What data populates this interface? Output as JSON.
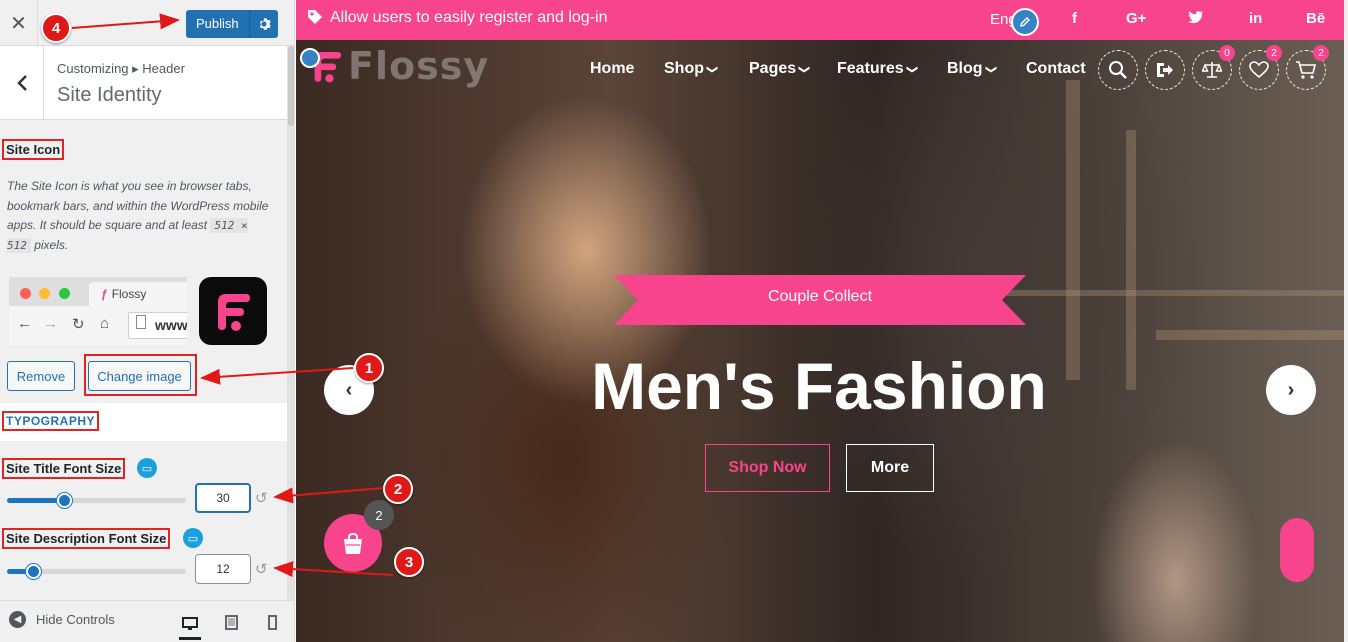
{
  "sidebar": {
    "close_label": "✕",
    "publish_label": "Publish",
    "breadcrumb": "Customizing ▸ Header",
    "section_title": "Site Identity",
    "site_icon": {
      "title": "Site Icon",
      "description": "The Site Icon is what you see in browser tabs, bookmark bars, and within the WordPress mobile apps. It should be square and at least",
      "size": "512 × 512",
      "size_suffix": "pixels.",
      "preview_tab_label": "Flossy",
      "preview_url": "www.",
      "remove_label": "Remove",
      "change_label": "Change image"
    },
    "typography_title": "TYPOGRAPHY",
    "title_font": {
      "label": "Site Title Font Size",
      "value": "30",
      "slider_fraction": 0.32
    },
    "desc_font": {
      "label": "Site Description Font Size",
      "value": "12",
      "slider_fraction": 0.15
    },
    "hide_controls_label": "Hide Controls"
  },
  "preview": {
    "notice": "Allow users to easily register and log-in",
    "lang": "Eng",
    "social": [
      "f",
      "G+",
      "twitter",
      "in",
      "Bē"
    ],
    "logo_text": "Flossy",
    "nav": [
      {
        "label": "Home",
        "has_dropdown": false
      },
      {
        "label": "Shop",
        "has_dropdown": true
      },
      {
        "label": "Pages",
        "has_dropdown": true
      },
      {
        "label": "Features",
        "has_dropdown": true
      },
      {
        "label": "Blog",
        "has_dropdown": true
      },
      {
        "label": "Contact",
        "has_dropdown": false
      }
    ],
    "badges": {
      "compare": "0",
      "wishlist": "2",
      "cart": "2"
    },
    "ribbon": "Couple Collect",
    "hero_title": "Men's Fashion",
    "shop_now": "Shop Now",
    "more": "More",
    "floating_cart_count": "2"
  },
  "annotations": [
    "1",
    "2",
    "3",
    "4"
  ],
  "colors": {
    "accent": "#f7448d",
    "wp_blue": "#2271b1",
    "annotation_red": "#e01818"
  }
}
